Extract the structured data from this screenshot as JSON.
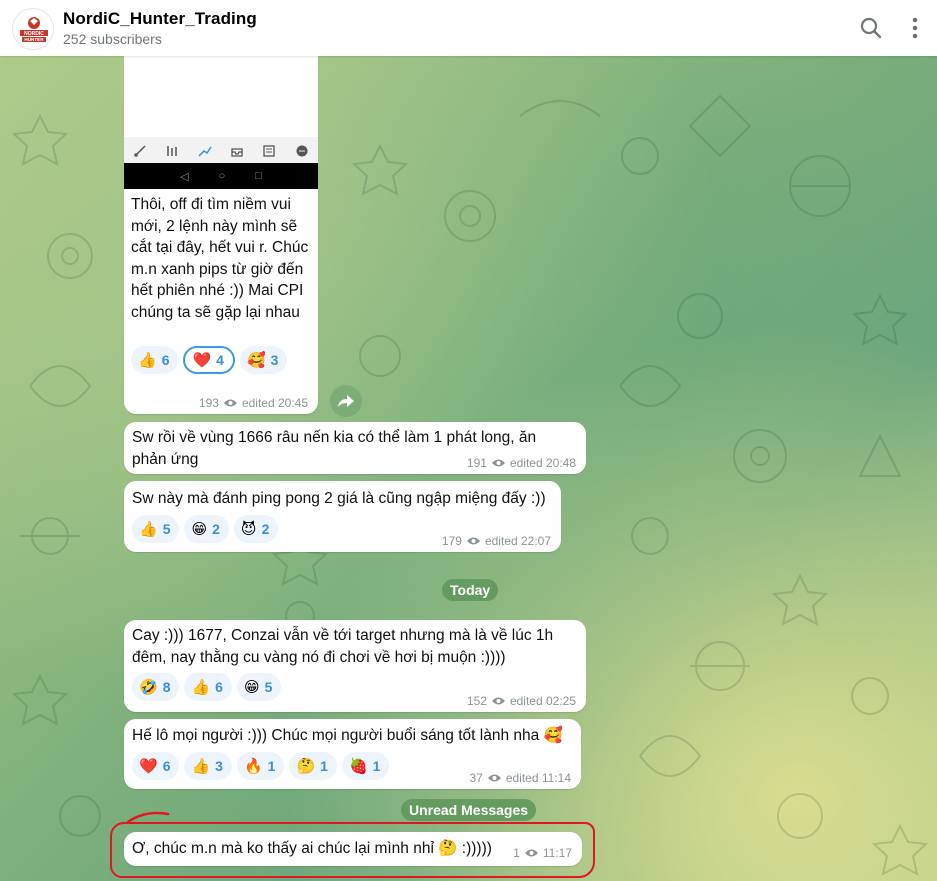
{
  "header": {
    "title": "NordiC_Hunter_Trading",
    "subtitle": "252 subscribers",
    "avatar_text": "NORDIC HUNTER"
  },
  "messages": [
    {
      "text": "Thôi, off đi tìm niềm vui mới, 2 lệnh này mình sẽ cắt tại đây, hết vui r. Chúc m.n xanh pips từ giờ đến hết phiên nhé :)) Mai CPI chúng ta sẽ gặp lại nhau",
      "reactions": [
        {
          "emoji": "👍",
          "count": "6"
        },
        {
          "emoji": "❤️",
          "count": "4"
        },
        {
          "emoji": "🥰",
          "count": "3"
        }
      ],
      "views": "193",
      "time": "edited 20:45"
    },
    {
      "text": "Sw rồi về vùng 1666 râu nến kia có thể làm 1 phát long, ăn phản ứng",
      "views": "191",
      "time": "edited 20:48"
    },
    {
      "text": "Sw này mà đánh ping pong 2 giá là cũng ngập miệng đấy :))",
      "reactions": [
        {
          "emoji": "👍",
          "count": "5"
        },
        {
          "emoji": "😁",
          "count": "2"
        },
        {
          "emoji": "😈",
          "count": "2"
        }
      ],
      "views": "179",
      "time": "edited 22:07"
    },
    {
      "text": "Cay :))) 1677, Conzai vẫn về tới target nhưng mà là về lúc 1h đêm, nay thằng cu vàng nó đi chơi về hơi bị muộn :))))",
      "reactions": [
        {
          "emoji": "🤣",
          "count": "8"
        },
        {
          "emoji": "👍",
          "count": "6"
        },
        {
          "emoji": "😁",
          "count": "5"
        }
      ],
      "views": "152",
      "time": "edited 02:25"
    },
    {
      "text": "Hế lô mọi người :))) Chúc mọi người buổi sáng tốt lành nha 🥰",
      "reactions": [
        {
          "emoji": "❤️",
          "count": "6"
        },
        {
          "emoji": "👍",
          "count": "3"
        },
        {
          "emoji": "🔥",
          "count": "1"
        },
        {
          "emoji": "🤔",
          "count": "1"
        },
        {
          "emoji": "🍓",
          "count": "1"
        }
      ],
      "views": "37",
      "time": "edited 11:14"
    },
    {
      "text": "Ơ, chúc m.n mà ko thấy ai chúc lại mình nhỉ 🤔 :)))))",
      "views": "1",
      "time": "11:17"
    }
  ],
  "separators": {
    "today": "Today",
    "unread": "Unread Messages"
  },
  "icons": {
    "search": "search-icon",
    "menu": "more-vertical-icon",
    "share": "share-icon",
    "views": "eye-icon"
  },
  "colors": {
    "accent": "#3a8fd8",
    "annotation": "#e0181f"
  }
}
